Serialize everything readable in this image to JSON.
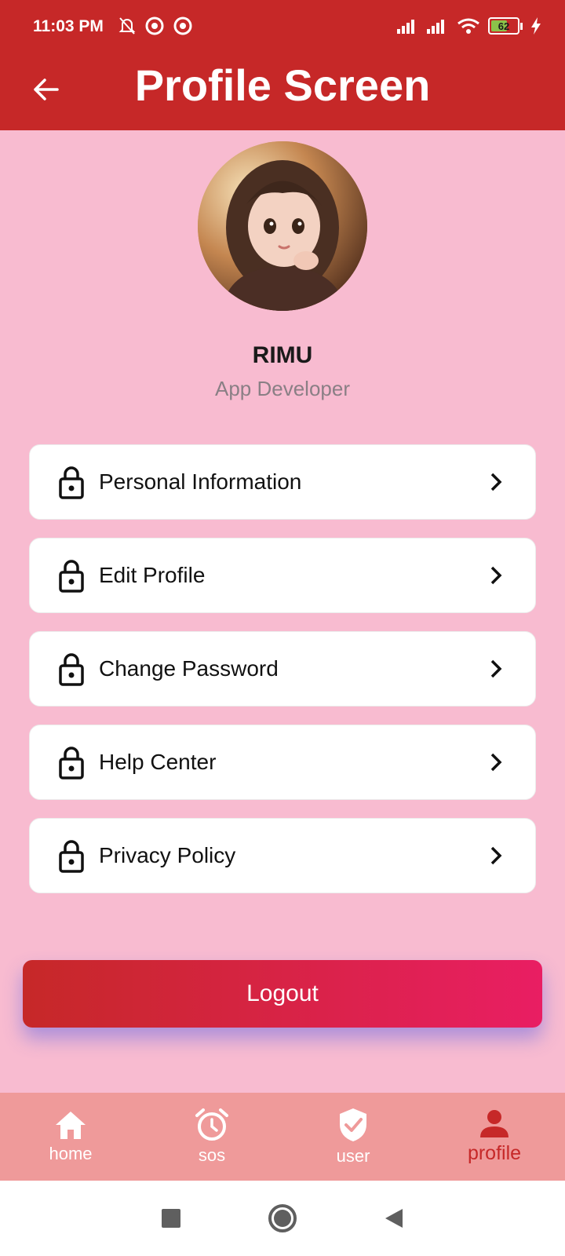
{
  "status_bar": {
    "time": "11:03 PM",
    "battery": "62",
    "battery_level": 0.62,
    "icons": [
      "mute-bell-icon",
      "app-notification-icon",
      "app-notification-icon",
      "signal-icon",
      "signal-icon",
      "wifi-icon",
      "battery-icon",
      "charging-icon"
    ]
  },
  "appbar": {
    "title": "Profile Screen",
    "back_icon": "arrow-left-icon"
  },
  "profile": {
    "name": "RIMU",
    "role": "App Developer"
  },
  "menu": {
    "items": [
      {
        "label": "Personal Information",
        "icon": "lock-icon"
      },
      {
        "label": "Edit Profile",
        "icon": "lock-icon"
      },
      {
        "label": "Change Password",
        "icon": "lock-icon"
      },
      {
        "label": "Help Center",
        "icon": "lock-icon"
      },
      {
        "label": "Privacy Policy",
        "icon": "lock-icon"
      }
    ]
  },
  "logout": {
    "label": "Logout"
  },
  "bottom_nav": {
    "items": [
      {
        "label": "home",
        "icon": "home-icon"
      },
      {
        "label": "sos",
        "icon": "alarm-clock-icon"
      },
      {
        "label": "user",
        "icon": "shield-check-icon"
      },
      {
        "label": "profile",
        "icon": "person-icon",
        "active": true
      }
    ]
  },
  "colors": {
    "primary": "#c62828",
    "background": "#f8bbd0",
    "nav_background": "#ef9a9a",
    "logout_gradient_end": "#e91e63"
  }
}
